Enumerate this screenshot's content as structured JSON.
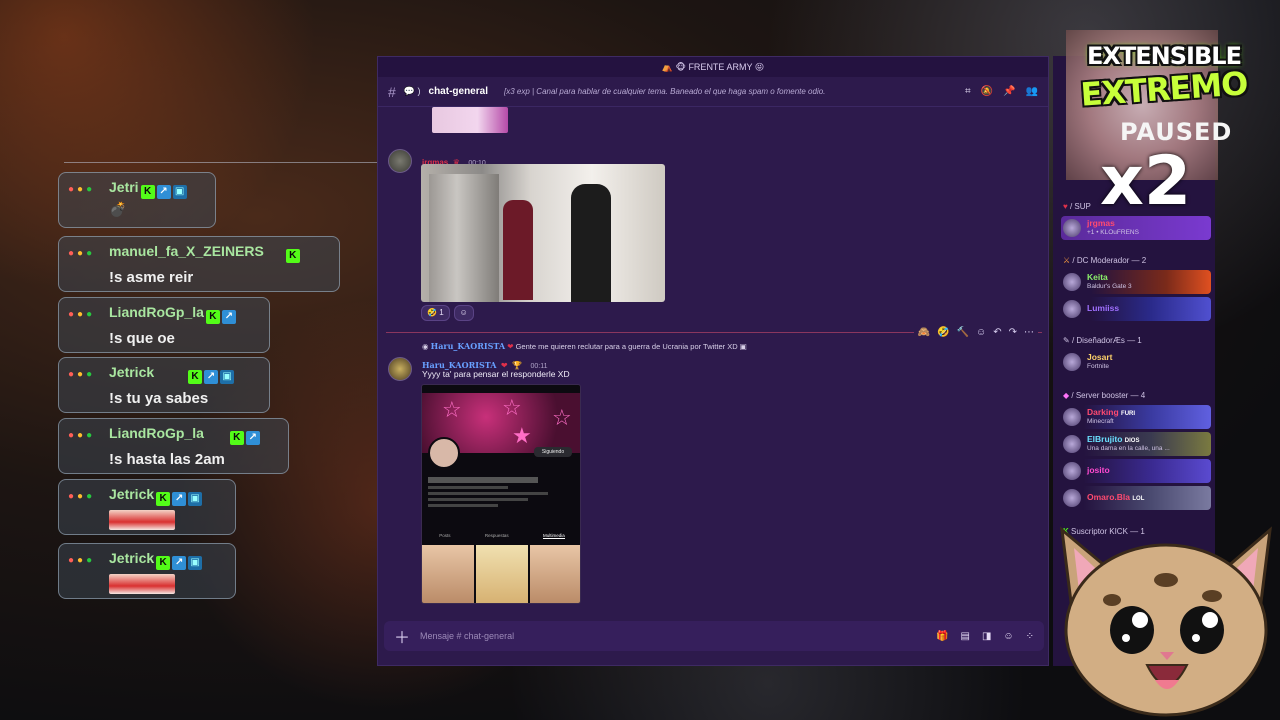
{
  "kick_chat": [
    {
      "user": "Jetri",
      "badges": [
        "k",
        "s",
        "v"
      ],
      "text": "",
      "emote": "bomb"
    },
    {
      "user": "manuel_fa_X_ZEINERS",
      "badges": [
        "k"
      ],
      "text": "!s asme reir"
    },
    {
      "user": "LiandRoGp_la",
      "badges": [
        "k",
        "s"
      ],
      "text": "!s que oe"
    },
    {
      "user": "Jetrick",
      "badges": [
        "k",
        "s",
        "v"
      ],
      "text": "!s tu ya sabes"
    },
    {
      "user": "LiandRoGp_la",
      "badges": [
        "k",
        "s"
      ],
      "text": "!s hasta las 2am"
    },
    {
      "user": "Jetrick",
      "badges": [
        "k",
        "s",
        "v"
      ],
      "text": "",
      "emote": "image"
    },
    {
      "user": "Jetrick",
      "badges": [
        "k",
        "s",
        "v"
      ],
      "text": "",
      "emote": "image"
    }
  ],
  "discord": {
    "server_name": "FRENTE ARMY",
    "channel": {
      "name": "chat-general",
      "topic": "[x3 exp | Canal para hablar de cualquier tema. Baneado el que haga spam o fomente odio."
    },
    "messages": {
      "msg1": {
        "user": "jrgmas",
        "time": "00:10",
        "reaction_count": "1"
      },
      "msg2": {
        "reply_user": "Haru_KAORISTA",
        "reply_text": "Gente me quieren reclutar para a guerra de Ucrania por Twitter XD",
        "user": "Haru_KAORISTA",
        "time": "00:11",
        "text": "Yyyy ta' para pensar el responderle XD",
        "phone_follow": "Siguiendo",
        "phone_tabs": [
          "Posts",
          "Respuestas",
          "Multimedia"
        ]
      }
    },
    "input_placeholder": "Mensaje # chat-general"
  },
  "members": {
    "sections": [
      {
        "label": "/ SUP"
      },
      {
        "label": "/ DC Moderador — 2"
      },
      {
        "label": "/ DiseñadorÆs — 1"
      },
      {
        "label": "/ Server booster — 4"
      },
      {
        "label": "Suscriptor KICK — 1"
      }
    ],
    "items": [
      {
        "name": "jrgmas",
        "sub": "+1 • KLOuFRENS",
        "color": "#ff4a70"
      },
      {
        "name": "Keita",
        "sub": "Baldur's Gate 3",
        "color": "#8cf06a"
      },
      {
        "name": "Lumiiss",
        "sub": "",
        "color": "#a070ff"
      },
      {
        "name": "Josart",
        "sub": "Fortnite",
        "color": "#ffd36a"
      },
      {
        "name": "Darking",
        "sub": "Minecraft",
        "color": "#ff4a70",
        "tag": "FURI"
      },
      {
        "name": "ElBrujito",
        "sub": "Una dama en la calle, una ...",
        "color": "#6ae0ff",
        "tag": "DIOS"
      },
      {
        "name": "josito",
        "sub": "",
        "color": "#ff4ad0"
      },
      {
        "name": "Omaro.Bla",
        "sub": "",
        "color": "#ff4a70",
        "tag": "LOL"
      }
    ]
  },
  "overlay": {
    "title_line1": "EXTENSIBLE",
    "title_line2": "EXTREMO",
    "status": "PAUSED",
    "multiplier": "x2"
  }
}
